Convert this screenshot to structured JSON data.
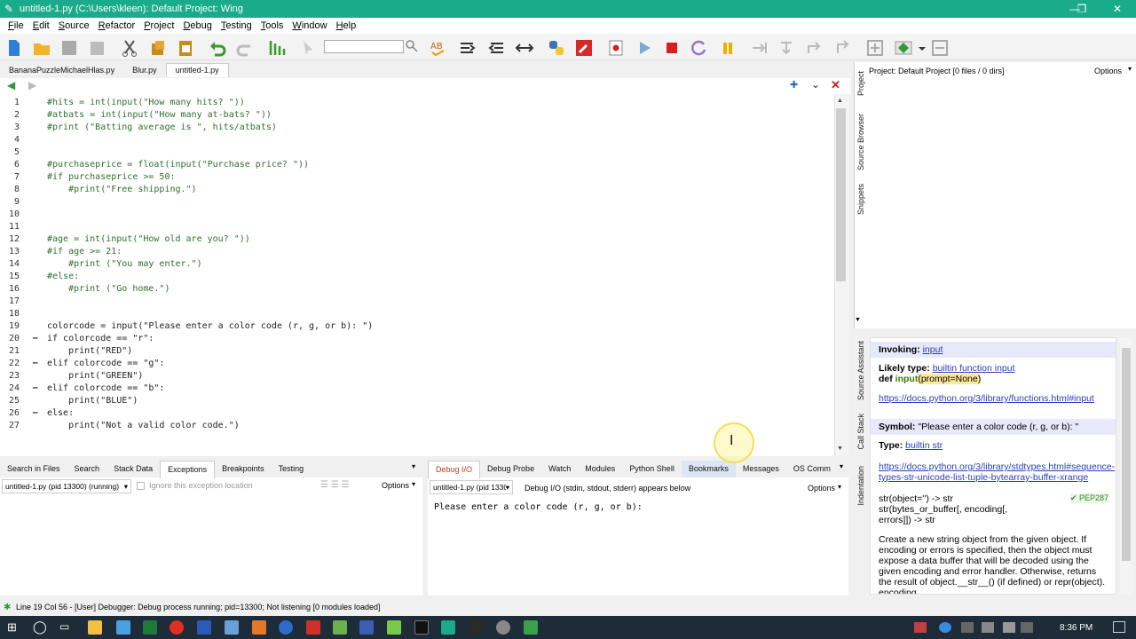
{
  "window": {
    "title": "untitled-1.py (C:\\Users\\kleen): Default Project: Wing"
  },
  "menu": [
    "File",
    "Edit",
    "Source",
    "Refactor",
    "Project",
    "Debug",
    "Testing",
    "Tools",
    "Window",
    "Help"
  ],
  "file_tabs": [
    "BananaPuzzleMichaelHlas.py",
    "Blur.py",
    "untitled-1.py"
  ],
  "editor": {
    "lines": [
      {
        "n": "1",
        "code": "#hits = int(input(\"How many hits? \"))"
      },
      {
        "n": "2",
        "code": "#atbats = int(input(\"How many at-bats? \"))"
      },
      {
        "n": "3",
        "code": "#print (\"Batting average is \", hits/atbats)"
      },
      {
        "n": "4",
        "code": ""
      },
      {
        "n": "5",
        "code": ""
      },
      {
        "n": "6",
        "code": "#purchaseprice = float(input(\"Purchase price? \"))"
      },
      {
        "n": "7",
        "code": "#if purchaseprice >= 50:"
      },
      {
        "n": "8",
        "code": "    #print(\"Free shipping.\")"
      },
      {
        "n": "9",
        "code": ""
      },
      {
        "n": "10",
        "code": ""
      },
      {
        "n": "11",
        "code": ""
      },
      {
        "n": "12",
        "code": "#age = int(input(\"How old are you? \"))"
      },
      {
        "n": "13",
        "code": "#if age >= 21:"
      },
      {
        "n": "14",
        "code": "    #print (\"You may enter.\")"
      },
      {
        "n": "15",
        "code": "#else:"
      },
      {
        "n": "16",
        "code": "    #print (\"Go home.\")"
      },
      {
        "n": "17",
        "code": ""
      },
      {
        "n": "18",
        "code": ""
      },
      {
        "n": "19",
        "code": "colorcode = input(\"Please enter a color code (r, g, or b): \")"
      },
      {
        "n": "20",
        "code": "if colorcode == \"r\":"
      },
      {
        "n": "21",
        "code": "    print(\"RED\")"
      },
      {
        "n": "22",
        "code": "elif colorcode == \"g\":"
      },
      {
        "n": "23",
        "code": "    print(\"GREEN\")"
      },
      {
        "n": "24",
        "code": "elif colorcode == \"b\":"
      },
      {
        "n": "25",
        "code": "    print(\"BLUE\")"
      },
      {
        "n": "26",
        "code": "else:"
      },
      {
        "n": "27",
        "code": "    print(\"Not a valid color code.\")"
      }
    ]
  },
  "project_panel": {
    "header": "Project: Default Project [0 files / 0 dirs]",
    "options": "Options",
    "vtabs": [
      "Project",
      "Source Browser",
      "Snippets"
    ]
  },
  "assistant": {
    "vtabs": [
      "Source Assistant",
      "Call Stack",
      "Indentation"
    ],
    "invoking_label": "Invoking:",
    "invoking_value": "input",
    "likely_type_label": "Likely type:",
    "likely_type_value": "builtin function input",
    "signature_def": "def ",
    "signature_name": "input",
    "signature_args": "(prompt=None)",
    "doc_link1": "https://docs.python.org/3/library/functions.html#input",
    "symbol_label": "Symbol:",
    "symbol_value": "\"Please enter a color code (r, g, or b): \"",
    "type_label": "Type:",
    "type_value": "builtin str",
    "doc_link2": "https://docs.python.org/3/library/stdtypes.html#sequence-types-str-unicode-list-tuple-bytearray-buffer-xrange",
    "str_sig": "str(object='') -> str str(bytes_or_buffer[, encoding[, errors]]) -> str",
    "pep": "✔ PEP287",
    "desc": "Create a new string object from the given object. If encoding or errors is specified, then the object must expose a data buffer that will be decoded using the given encoding and error handler. Otherwise, returns the result of object.__str__() (if defined) or repr(object). encoding"
  },
  "bottom_left": {
    "tabs": [
      "Search in Files",
      "Search",
      "Stack Data",
      "Exceptions",
      "Breakpoints",
      "Testing"
    ],
    "process": "untitled-1.py (pid 13300) (running)",
    "ignore": "Ignore this exception location",
    "options": "Options"
  },
  "bottom_right": {
    "tabs": [
      "Debug I/O",
      "Debug Probe",
      "Watch",
      "Modules",
      "Python Shell",
      "Bookmarks",
      "Messages",
      "OS Comm"
    ],
    "process": "untitled-1.py (pid 1330",
    "info": "Debug I/O (stdin, stdout, stderr) appears below",
    "options": "Options",
    "output": "Please enter a color code (r, g, or b):"
  },
  "status": "Line 19 Col 56 - [User] Debugger: Debug process running; pid=13300; Not listening [0 modules loaded]",
  "taskbar": {
    "time": "8:36 PM"
  }
}
